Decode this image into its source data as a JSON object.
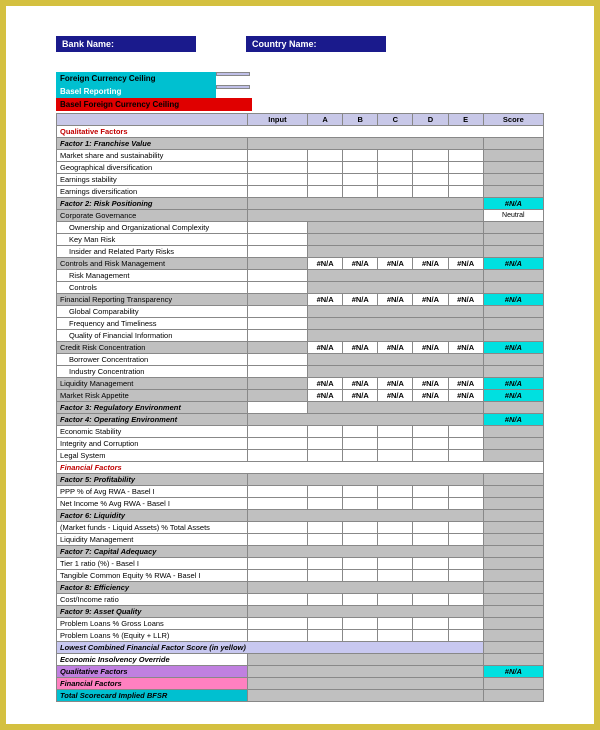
{
  "header": {
    "bank_label": "Bank Name:",
    "country_label": "Country Name:"
  },
  "meta": {
    "fcc": "Foreign Currency Ceiling",
    "basel": "Basel Reporting",
    "redbar": "Basel Foreign Currency Ceiling"
  },
  "cols": {
    "input": "Input",
    "a": "A",
    "b": "B",
    "c": "C",
    "d": "D",
    "e": "E",
    "score": "Score"
  },
  "na": "#N/A",
  "neutral": "Neutral",
  "sections": {
    "qualitative": "Qualitative Factors",
    "f1": "Factor 1: Franchise Value",
    "f1_items": [
      "Market share and sustainability",
      "Geographical diversification",
      "Earnings stability",
      "Earnings diversification"
    ],
    "f2": "Factor 2: Risk Positioning",
    "f2_corp": "Corporate Governance",
    "f2_corp_items": [
      "Ownership and Organizational Complexity",
      "Key Man Risk",
      "Insider and Related Party Risks"
    ],
    "f2_ctrl": "Controls and Risk Management",
    "f2_ctrl_items": [
      "Risk Management",
      "Controls"
    ],
    "f2_fin": "Financial Reporting Transparency",
    "f2_fin_items": [
      "Global Comparability",
      "Frequency and Timeliness",
      "Quality of Financial Information"
    ],
    "f2_credit": "Credit Risk Concentration",
    "f2_credit_items": [
      "Borrower Concentration",
      "Industry Concentration"
    ],
    "f2_liq": "Liquidity Management",
    "f2_mkt": "Market Risk Appetite",
    "f3": "Factor 3: Regulatory Environment",
    "f4": "Factor 4: Operating Environment",
    "f4_items": [
      "Economic Stability",
      "Integrity and Corruption",
      "Legal System"
    ],
    "financial": "Financial Factors",
    "f5": "Factor 5: Profitability",
    "f5_items": [
      "PPP % of Avg RWA - Basel I",
      "Net Income % Avg RWA - Basel I"
    ],
    "f6": "Factor 6: Liquidity",
    "f6_items": [
      "(Market funds - Liquid Assets) % Total Assets",
      "Liquidity Management"
    ],
    "f7": "Factor 7: Capital Adequacy",
    "f7_items": [
      "Tier 1 ratio (%) - Basel I",
      "Tangible Common Equity  % RWA - Basel I"
    ],
    "f8": "Factor 8: Efficiency",
    "f8_items": [
      "Cost/Income ratio"
    ],
    "f9": "Factor 9: Asset Quality",
    "f9_items": [
      "Problem Loans % Gross Loans",
      "Problem Loans % (Equity + LLR)"
    ],
    "lowest": "Lowest Combined Financial Factor Score (in yellow)",
    "econ": "Economic Insolvency Override",
    "qual_final": "Qualitative Factors",
    "fin_final": "Financial Factors",
    "total": "Total Scorecard Implied BFSR"
  }
}
